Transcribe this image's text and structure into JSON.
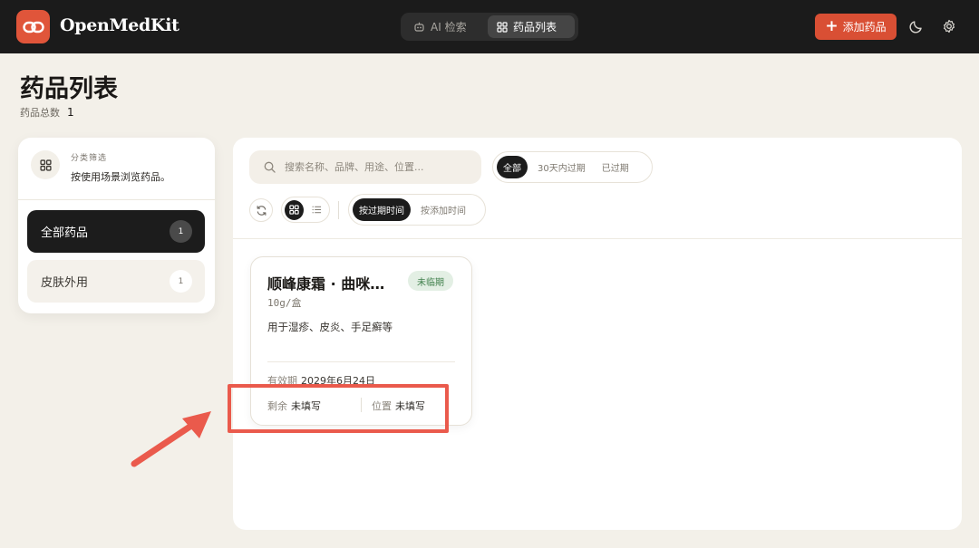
{
  "header": {
    "app_title": "OpenMedKit",
    "nav": [
      {
        "label": "AI 检索",
        "icon": "robot-icon"
      },
      {
        "label": "药品列表",
        "icon": "grid-icon",
        "active": true
      }
    ],
    "add_button": "添加药品",
    "icons": [
      "moon-icon",
      "gear-icon"
    ]
  },
  "page": {
    "title": "药品列表",
    "total_label": "药品总数",
    "total_value": "1"
  },
  "sidebar": {
    "filter_label": "分类筛选",
    "filter_desc": "按使用场景浏览药品。",
    "categories": [
      {
        "label": "全部药品",
        "count": "1",
        "active": true
      },
      {
        "label": "皮肤外用",
        "count": "1",
        "active": false
      }
    ]
  },
  "toolbar": {
    "search_placeholder": "搜索名称、品牌、用途、位置...",
    "status_filters": [
      {
        "label": "全部",
        "active": true
      },
      {
        "label": "30天内过期",
        "active": false
      },
      {
        "label": "已过期",
        "active": false
      }
    ],
    "sort_options": [
      {
        "label": "按过期时间",
        "active": true
      },
      {
        "label": "按添加时间",
        "active": false
      }
    ],
    "view_modes": [
      "grid-icon",
      "list-icon"
    ]
  },
  "cards": [
    {
      "name": "顺峰康霜 · 曲咪…",
      "badge": "未临期",
      "spec": "10g/盒",
      "usage": "用于湿疹、皮炎、手足癣等",
      "expiry_label": "有效期",
      "expiry_value": "2029年6月24日",
      "remain_label": "剩余",
      "remain_value": "未填写",
      "location_label": "位置",
      "location_value": "未填写"
    }
  ],
  "colors": {
    "accent": "#d94f34",
    "topbar": "#1b1b1b",
    "background": "#f3f0e9",
    "badge_bg": "#e3efe4",
    "badge_text": "#3f7f4a",
    "annotation": "#ea5a4c"
  }
}
